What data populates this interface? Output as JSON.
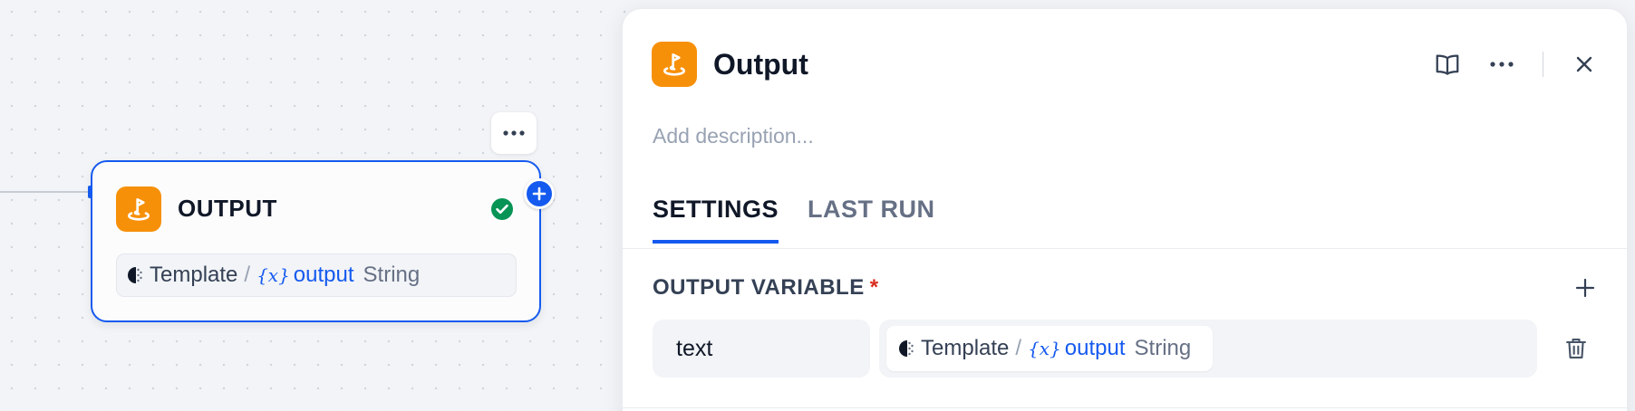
{
  "canvas": {
    "node": {
      "title": "OUTPUT",
      "icon": "flag-location-icon",
      "status_icon": "check-circle-icon",
      "more_icon": "more-horizontal-icon",
      "add_icon": "plus-icon",
      "variable": {
        "source": "Template",
        "separator": "/",
        "brace": "{x}",
        "name": "output",
        "type": "String"
      }
    }
  },
  "panel": {
    "title": "Output",
    "icon": "flag-location-icon",
    "description_placeholder": "Add description...",
    "actions": [
      "book-open-icon",
      "more-horizontal-icon",
      "close-icon"
    ],
    "tabs": [
      {
        "label": "SETTINGS",
        "active": true
      },
      {
        "label": "LAST RUN",
        "active": false
      }
    ],
    "output_section": {
      "label": "OUTPUT VARIABLE",
      "required_mark": "*",
      "add_icon": "plus-icon",
      "rows": [
        {
          "key": "text",
          "source": "Template",
          "separator": "/",
          "brace": "{x}",
          "name": "output",
          "type": "String",
          "delete_icon": "trash-icon"
        }
      ]
    }
  },
  "colors": {
    "accent": "#155aef",
    "node_icon_bg": "#f79009",
    "success": "#079455",
    "required": "#d92d20"
  }
}
